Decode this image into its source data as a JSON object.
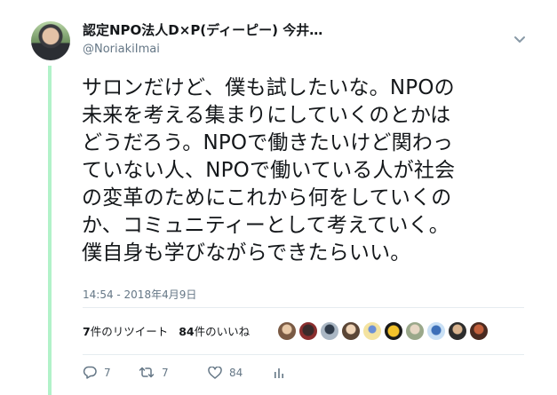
{
  "tweet": {
    "display_name": "認定NPO法人D×P(ディーピー) 今井…",
    "handle": "@NoriakiImai",
    "text_lines": [
      "サロンだけど、僕も試したいな。NPOの",
      "未来を考える集まりにしていくのとかは",
      "どうだろう。NPOで働きたいけど関わっ",
      "ていない人、NPOで働いている人が社会",
      "の変革のためにこれから何をしていくの",
      "か、コミュニティーとして考えていく。",
      "僕自身も学びながらできたらいい。"
    ],
    "timestamp": "14:54 - 2018年4月9日",
    "stats": {
      "retweets_count": "7",
      "retweets_label": "件のリツイート",
      "likes_count": "84",
      "likes_label": "件のいいね"
    },
    "actions": {
      "reply_count": "7",
      "retweet_count": "7",
      "like_count": "84"
    }
  },
  "icons": {
    "more": "chevron-down-icon",
    "reply": "reply-icon",
    "retweet": "retweet-icon",
    "like": "heart-icon",
    "analytics": "analytics-icon"
  },
  "colors": {
    "thread_line": "#b2f2c9",
    "secondary_text": "#657786"
  }
}
